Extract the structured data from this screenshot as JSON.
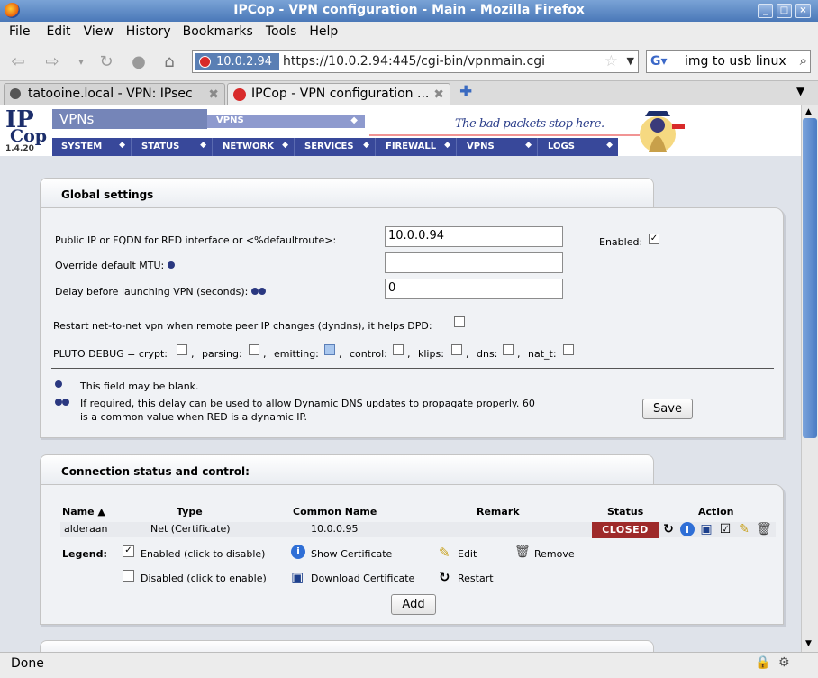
{
  "window": {
    "title": "IPCop - VPN configuration - Main - Mozilla Firefox"
  },
  "menu": [
    "File",
    "Edit",
    "View",
    "History",
    "Bookmarks",
    "Tools",
    "Help"
  ],
  "urlbar": {
    "site": "10.0.2.94",
    "url": "https://10.0.2.94:445/cgi-bin/vpnmain.cgi"
  },
  "search": {
    "value": "img to usb linux"
  },
  "tabs": [
    {
      "label": "tatooine.local - VPN: IPsec",
      "active": false
    },
    {
      "label": "IPCop - VPN configuration ...",
      "active": true
    }
  ],
  "header": {
    "logo_ip": "IP",
    "logo_cop": "Cop",
    "version": "1.4.20",
    "section": "VPNs",
    "subsection": "VPNS",
    "slogan": "The bad packets stop here.",
    "nav": [
      "SYSTEM",
      "STATUS",
      "NETWORK",
      "SERVICES",
      "FIREWALL",
      "VPNS",
      "LOGS"
    ]
  },
  "global": {
    "title": "Global settings",
    "red_label": "Public IP or FQDN for RED interface or <%defaultroute>:",
    "red_value": "10.0.0.94",
    "enabled_label": "Enabled:",
    "mtu_label": "Override default MTU:",
    "mtu_value": "",
    "delay_label": "Delay before launching VPN (seconds):",
    "delay_value": "0",
    "restart_label": "Restart net-to-net vpn when remote peer IP changes (dyndns), it helps DPD:",
    "pluto_label": "PLUTO DEBUG = crypt:",
    "debug": [
      "parsing:",
      "emitting:",
      "control:",
      "klips:",
      "dns:",
      "nat_t:"
    ],
    "note1": "This field may be blank.",
    "note2_line1": "If required, this delay can be used to allow Dynamic DNS updates to propagate properly. 60",
    "note2_line2": "is a common value when RED is a dynamic IP.",
    "save": "Save"
  },
  "connections": {
    "title": "Connection status and control:",
    "headers": {
      "name": "Name",
      "type": "Type",
      "common_name": "Common Name",
      "remark": "Remark",
      "status": "Status",
      "action": "Action"
    },
    "rows": [
      {
        "name": "alderaan",
        "type": "Net (Certificate)",
        "common_name": "10.0.0.95",
        "remark": "",
        "status": "CLOSED"
      }
    ],
    "legend": {
      "title": "Legend:",
      "enabled": "Enabled (click to disable)",
      "disabled": "Disabled (click to enable)",
      "show_cert": "Show Certificate",
      "download_cert": "Download Certificate",
      "edit": "Edit",
      "restart": "Restart",
      "remove": "Remove"
    },
    "add": "Add"
  },
  "statusbar": {
    "text": "Done"
  },
  "colors": {
    "nav_bg": "#38489a",
    "closed_bg": "#9e2a2a",
    "section_bg": "#7585b8"
  }
}
